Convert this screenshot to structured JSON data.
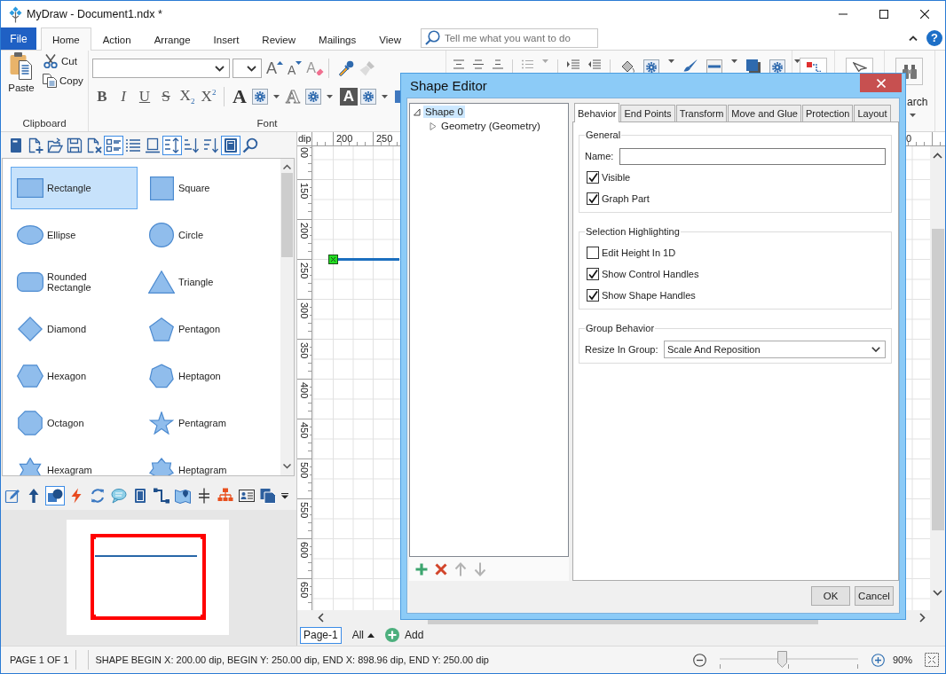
{
  "window": {
    "title": "MyDraw - Document1.ndx *"
  },
  "ribbon": {
    "file_button": "File",
    "tabs": [
      {
        "label": "Home",
        "selected": true
      },
      {
        "label": "Action",
        "selected": false
      },
      {
        "label": "Arrange",
        "selected": false
      },
      {
        "label": "Insert",
        "selected": false
      },
      {
        "label": "Review",
        "selected": false
      },
      {
        "label": "Mailings",
        "selected": false
      },
      {
        "label": "View",
        "selected": false
      }
    ],
    "search": {
      "placeholder": "Tell me what you want to do"
    },
    "help_button": "?",
    "clipboard": {
      "paste": "Paste",
      "cut": "Cut",
      "copy": "Copy",
      "label": "Clipboard"
    },
    "font": {
      "grow": "A",
      "shrink": "A",
      "clear": "A",
      "styles": [
        "B",
        "I",
        "U",
        "S",
        "X$_{2}$",
        "X$^{2}$"
      ],
      "effects": [
        "A",
        "A",
        "A"
      ],
      "label": "Font"
    },
    "find": {
      "label": "arch"
    }
  },
  "library_toolbar": [
    {
      "selected": false
    },
    {
      "selected": false
    },
    {
      "selected": false
    },
    {
      "selected": false
    },
    {
      "selected": false
    },
    {
      "selected": true
    },
    {
      "selected": false
    },
    {
      "selected": false
    },
    {
      "selected": true
    },
    {
      "selected": false
    },
    {
      "selected": false
    },
    {
      "selected": true
    },
    {
      "selected": false
    }
  ],
  "shapes": [
    {
      "kind": "rectangle",
      "label": "Rectangle",
      "selected": true
    },
    {
      "kind": "square",
      "label": "Square",
      "selected": false
    },
    {
      "kind": "ellipse",
      "label": "Ellipse",
      "selected": false
    },
    {
      "kind": "circle",
      "label": "Circle",
      "selected": false
    },
    {
      "kind": "rounded",
      "label": "Rounded Rectangle",
      "selected": false
    },
    {
      "kind": "triangle",
      "label": "Triangle",
      "selected": false
    },
    {
      "kind": "diamond",
      "label": "Diamond",
      "selected": false
    },
    {
      "kind": "pentagon",
      "label": "Pentagon",
      "selected": false
    },
    {
      "kind": "hexagon",
      "label": "Hexagon",
      "selected": false
    },
    {
      "kind": "heptagon",
      "label": "Heptagon",
      "selected": false
    },
    {
      "kind": "octagon",
      "label": "Octagon",
      "selected": false
    },
    {
      "kind": "pentagram",
      "label": "Pentagram",
      "selected": false
    },
    {
      "kind": "hexagram",
      "label": "Hexagram",
      "selected": false
    },
    {
      "kind": "heptagram",
      "label": "Heptagram",
      "selected": false
    }
  ],
  "tools_toolbar": [
    {
      "selected": false
    },
    {
      "selected": false
    },
    {
      "selected": true
    },
    {
      "selected": false
    },
    {
      "selected": false
    },
    {
      "selected": false
    },
    {
      "selected": false
    },
    {
      "selected": false
    },
    {
      "selected": false
    },
    {
      "selected": false
    },
    {
      "selected": false
    },
    {
      "selected": false
    },
    {
      "selected": false
    }
  ],
  "canvas": {
    "unit": "dip",
    "top_ruler": [
      "200",
      "250",
      "0"
    ],
    "left_ruler": [
      "00",
      "150",
      "200",
      "250",
      "300",
      "350",
      "400",
      "450",
      "500",
      "550",
      "600",
      "650"
    ]
  },
  "page_tabs": {
    "pages": [
      {
        "label": "Page-1",
        "selected": true
      }
    ],
    "filter": "All",
    "add": "Add"
  },
  "status_bar": {
    "page": "PAGE 1 OF 1",
    "selection": "SHAPE BEGIN X: 200.00 dip, BEGIN Y: 250.00 dip, END X: 898.96 dip, END Y: 250.00 dip",
    "zoom": {
      "level": 0.45,
      "reading": "90%"
    }
  },
  "dialog": {
    "title": "Shape Editor",
    "tree": [
      {
        "label": "Shape 0",
        "selected": true,
        "expanded": true,
        "children": [
          {
            "label": "Geometry (Geometry)",
            "selected": false,
            "expanded": false
          }
        ]
      }
    ],
    "tree_actions": [
      {
        "disabled": false
      },
      {
        "disabled": false
      },
      {
        "disabled": true
      },
      {
        "disabled": true
      }
    ],
    "tabs": [
      {
        "label": "Behavior",
        "selected": true
      },
      {
        "label": "End Points",
        "selected": false
      },
      {
        "label": "Transform",
        "selected": false
      },
      {
        "label": "Move and Glue",
        "selected": false
      },
      {
        "label": "Protection",
        "selected": false
      },
      {
        "label": "Layout",
        "selected": false
      }
    ],
    "groups": [
      {
        "title": "General",
        "items": [
          {
            "kind": "text",
            "label": "Name:"
          },
          {
            "kind": "checkbox",
            "label": "Visible",
            "checked": true
          },
          {
            "kind": "checkbox",
            "label": "Graph Part",
            "checked": true
          }
        ]
      },
      {
        "title": "Selection Highlighting",
        "items": [
          {
            "kind": "checkbox",
            "label": "Edit Height In 1D",
            "checked": false
          },
          {
            "kind": "checkbox",
            "label": "Show Control Handles",
            "checked": true
          },
          {
            "kind": "checkbox",
            "label": "Show Shape Handles",
            "checked": true
          }
        ]
      },
      {
        "title": "Group Behavior",
        "items": [
          {
            "kind": "select",
            "label": "Resize In Group:",
            "value": "Scale And Reposition"
          }
        ]
      }
    ],
    "buttons": [
      "OK",
      "Cancel"
    ]
  }
}
